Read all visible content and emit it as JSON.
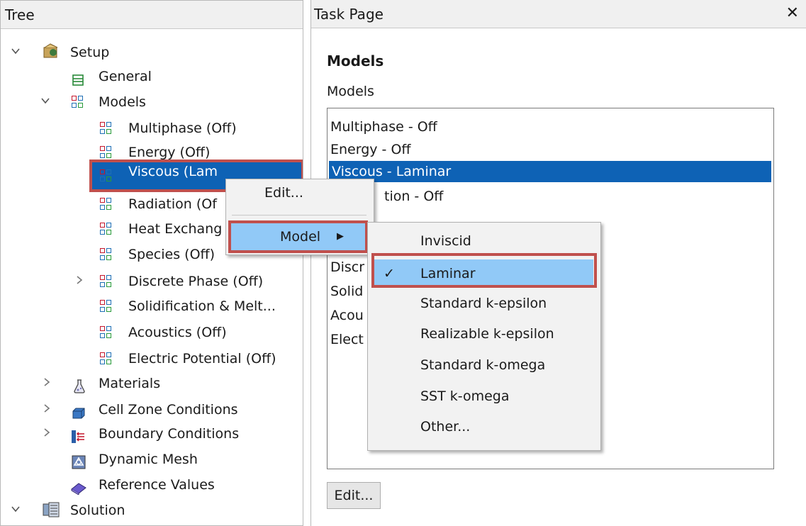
{
  "tree": {
    "header": "Tree",
    "items": [
      {
        "label": "Setup"
      },
      {
        "label": "General"
      },
      {
        "label": "Models"
      },
      {
        "label": "Multiphase (Off)"
      },
      {
        "label": "Energy (Off)"
      },
      {
        "label": "Viscous (Lam"
      },
      {
        "label": "Radiation (Of"
      },
      {
        "label": "Heat Exchang"
      },
      {
        "label": "Species (Off)"
      },
      {
        "label": "Discrete Phase (Off)"
      },
      {
        "label": "Solidification & Melt..."
      },
      {
        "label": "Acoustics (Off)"
      },
      {
        "label": "Electric Potential (Off)"
      },
      {
        "label": "Materials"
      },
      {
        "label": "Cell Zone Conditions"
      },
      {
        "label": "Boundary Conditions"
      },
      {
        "label": "Dynamic Mesh"
      },
      {
        "label": "Reference Values"
      },
      {
        "label": "Solution"
      }
    ]
  },
  "task": {
    "header": "Task Page",
    "close": "✕",
    "heading": "Models",
    "sublabel": "Models",
    "list": [
      "Multiphase - Off",
      "Energy - Off",
      "Viscous - Laminar",
      "tion - Off",
      "Discr",
      "Solid",
      "Acou",
      "Elect"
    ],
    "edit_button": "Edit..."
  },
  "context_menu": {
    "edit": "Edit...",
    "model": "Model",
    "arrow": "▶"
  },
  "submenu": {
    "check": "✓",
    "items": [
      "Inviscid",
      "Laminar",
      "Standard k-epsilon",
      "Realizable k-epsilon",
      "Standard k-omega",
      "SST k-omega",
      "Other..."
    ]
  },
  "icons": {
    "expand": "⌄",
    "collapsed": "›"
  },
  "colors": {
    "selection": "#0e62b5",
    "menu_highlight": "#91c9f7",
    "annotation": "#c0504d"
  }
}
